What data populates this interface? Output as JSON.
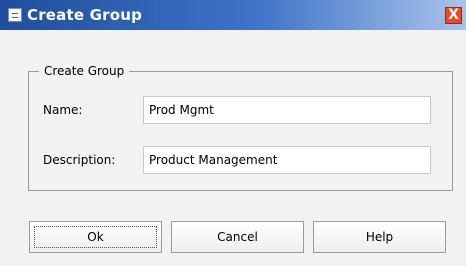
{
  "window": {
    "title": "Create Group",
    "close_label": "X"
  },
  "group": {
    "legend": "Create Group",
    "name_label": "Name:",
    "name_value": "Prod Mgmt",
    "description_label": "Description:",
    "description_value": "Product Management"
  },
  "buttons": {
    "ok": "Ok",
    "cancel": "Cancel",
    "help": "Help"
  }
}
